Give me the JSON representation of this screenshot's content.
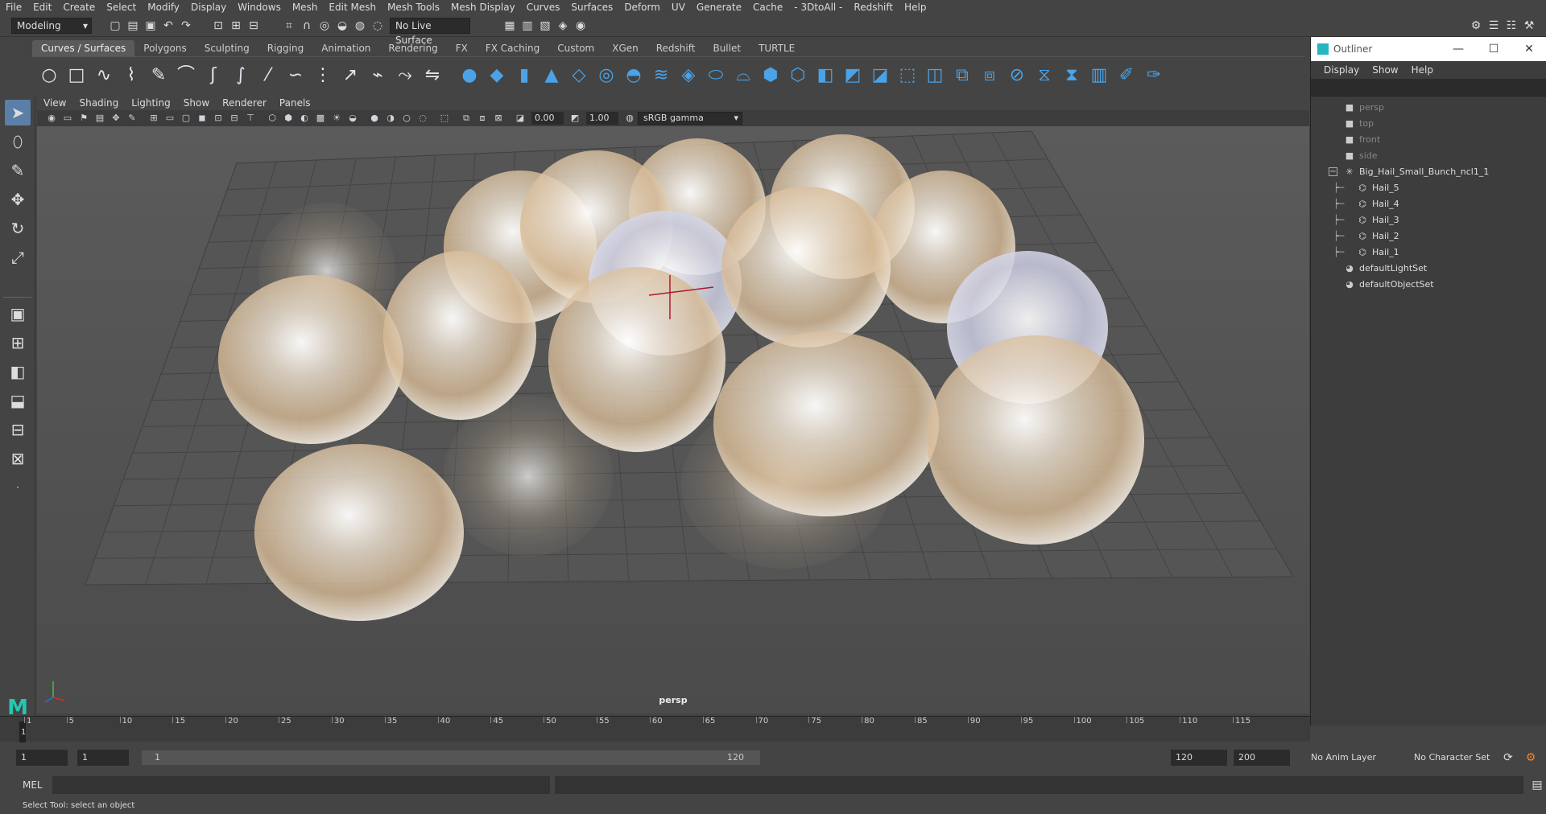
{
  "menubar": [
    "File",
    "Edit",
    "Create",
    "Select",
    "Modify",
    "Display",
    "Windows",
    "Mesh",
    "Edit Mesh",
    "Mesh Tools",
    "Mesh Display",
    "Curves",
    "Surfaces",
    "Deform",
    "UV",
    "Generate",
    "Cache",
    "- 3DtoAll -",
    "Redshift",
    "Help"
  ],
  "workspace": {
    "mode": "Modeling",
    "live_surface": "No Live Surface"
  },
  "shelf_tabs": [
    "Curves / Surfaces",
    "Polygons",
    "Sculpting",
    "Rigging",
    "Animation",
    "Rendering",
    "FX",
    "FX Caching",
    "Custom",
    "XGen",
    "Redshift",
    "Bullet",
    "TURTLE"
  ],
  "panel_menu": [
    "View",
    "Shading",
    "Lighting",
    "Show",
    "Renderer",
    "Panels"
  ],
  "panel_toolbar": {
    "exposure": "0.00",
    "gamma": "1.00",
    "color_space": "sRGB gamma"
  },
  "viewport": {
    "camera_label": "persp"
  },
  "outliner": {
    "title": "Outliner",
    "menu": [
      "Display",
      "Show",
      "Help"
    ],
    "items": [
      {
        "label": "persp",
        "dim": true,
        "indent": 1,
        "icon": "camera-icon"
      },
      {
        "label": "top",
        "dim": true,
        "indent": 1,
        "icon": "camera-icon"
      },
      {
        "label": "front",
        "dim": true,
        "indent": 1,
        "icon": "camera-icon"
      },
      {
        "label": "side",
        "dim": true,
        "indent": 1,
        "icon": "camera-icon"
      },
      {
        "label": "Big_Hail_Small_Bunch_ncl1_1",
        "dim": false,
        "indent": 1,
        "icon": "transform-icon",
        "expand": "−"
      },
      {
        "label": "Hail_5",
        "dim": false,
        "indent": 2,
        "icon": "mesh-icon"
      },
      {
        "label": "Hail_4",
        "dim": false,
        "indent": 2,
        "icon": "mesh-icon"
      },
      {
        "label": "Hail_3",
        "dim": false,
        "indent": 2,
        "icon": "mesh-icon"
      },
      {
        "label": "Hail_2",
        "dim": false,
        "indent": 2,
        "icon": "mesh-icon"
      },
      {
        "label": "Hail_1",
        "dim": false,
        "indent": 2,
        "icon": "mesh-icon"
      },
      {
        "label": "defaultLightSet",
        "dim": false,
        "indent": 1,
        "icon": "set-icon"
      },
      {
        "label": "defaultObjectSet",
        "dim": false,
        "indent": 1,
        "icon": "set-icon"
      }
    ]
  },
  "timeline": {
    "ticks": [
      "1",
      "5",
      "10",
      "15",
      "20",
      "25",
      "30",
      "35",
      "40",
      "45",
      "50",
      "55",
      "60",
      "65",
      "70",
      "75",
      "80",
      "85",
      "90",
      "95",
      "100",
      "105",
      "110",
      "115"
    ],
    "current_frame": "1"
  },
  "range": {
    "start": "1",
    "playback_start": "1",
    "slider_start": "1",
    "slider_end": "120",
    "playback_end": "120",
    "end": "200",
    "anim_layer": "No Anim Layer",
    "char_set": "No Character Set"
  },
  "cmdline": {
    "label": "MEL"
  },
  "helpline": "Select Tool: select an object"
}
